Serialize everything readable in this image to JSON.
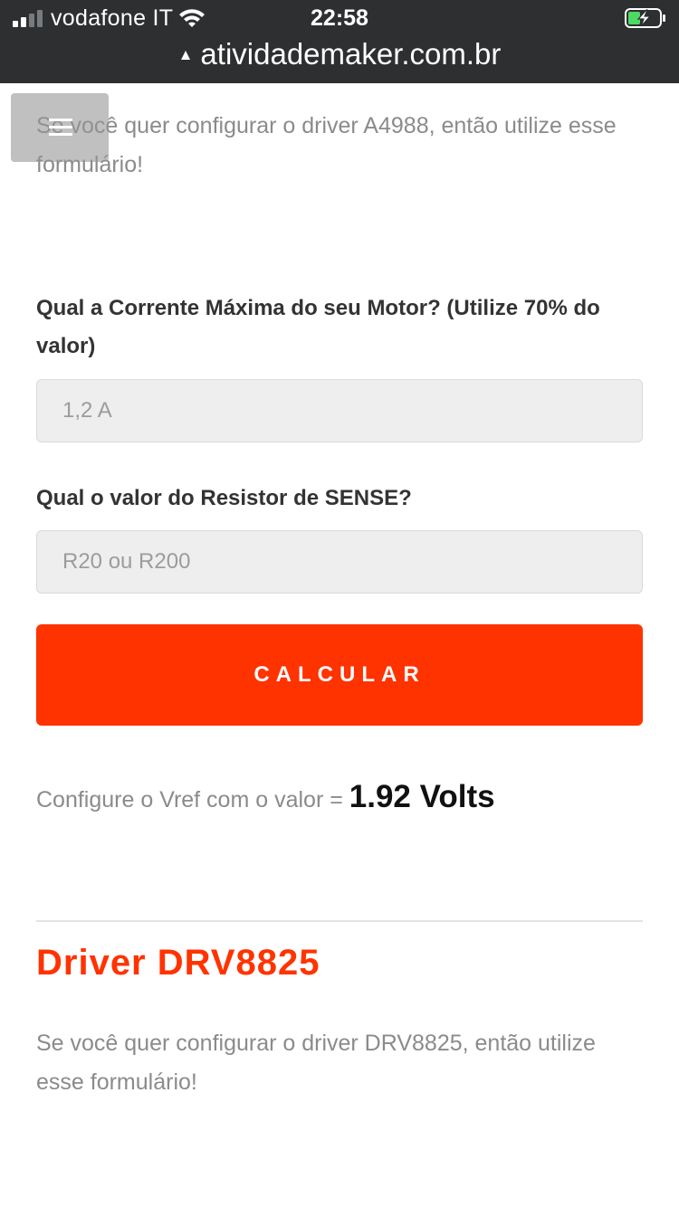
{
  "status_bar": {
    "carrier": "vodafone IT",
    "time": "22:58",
    "signal_bars_filled": 2,
    "signal_bars_total": 4,
    "battery_state": "charging"
  },
  "browser": {
    "url": "atividademaker.com.br",
    "security_icon": "warning-triangle-icon"
  },
  "menu": {
    "icon": "hamburger-menu-icon"
  },
  "form_a4988": {
    "intro": "Se você quer configurar o driver A4988, então utilize esse formulário!",
    "current_label": "Qual a Corrente Máxima do seu Motor? (Utilize 70% do valor)",
    "current_placeholder": "1,2 A",
    "sense_label": "Qual o valor do Resistor de SENSE?",
    "sense_placeholder": "R20 ou R200",
    "calculate_button": "CALCULAR",
    "result_prefix": "Configure o Vref com o valor = ",
    "result_value": "1.92 Volts"
  },
  "section_drv8825": {
    "heading": "Driver DRV8825",
    "intro": "Se você quer configurar o driver DRV8825, então utilize esse formulário!"
  },
  "colors": {
    "accent": "#ff3300",
    "topbar": "#2e2f31",
    "field_bg": "#eeeeee",
    "muted_text": "#8b8b8b"
  }
}
